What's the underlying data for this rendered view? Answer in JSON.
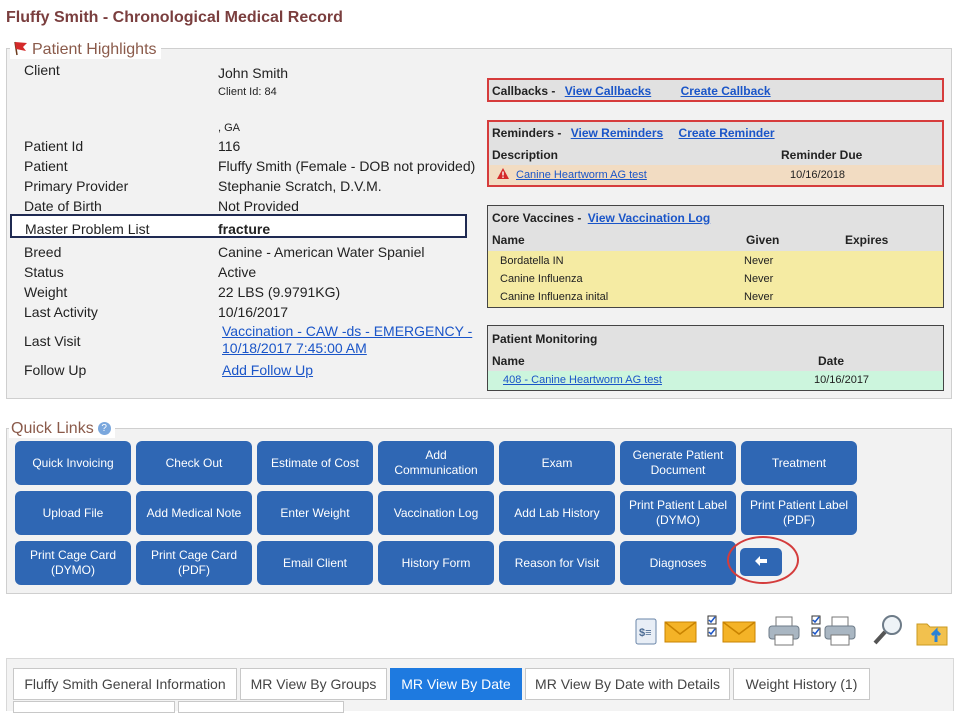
{
  "page": {
    "title": "Fluffy Smith - Chronological Medical Record"
  },
  "highlights": {
    "legend": "Patient Highlights",
    "client_label": "Client",
    "client_name": "John Smith",
    "client_id": "Client Id: 84",
    "address": ", GA",
    "rows": [
      {
        "label": "Patient Id",
        "value": "116"
      },
      {
        "label": "Patient",
        "value": "Fluffy Smith (Female - DOB not provided)"
      },
      {
        "label": "Primary Provider",
        "value": "Stephanie Scratch, D.V.M."
      },
      {
        "label": "Date of Birth",
        "value": "Not Provided"
      }
    ],
    "problem_label": "Master Problem List",
    "problem_value": "fracture",
    "rows2": [
      {
        "label": "Breed",
        "value": "Canine - American Water Spaniel"
      },
      {
        "label": "Status",
        "value": "Active"
      },
      {
        "label": "Weight",
        "value": "22 LBS (9.9791KG)"
      },
      {
        "label": "Last Activity",
        "value": "10/16/2017"
      }
    ],
    "last_visit_label": "Last Visit",
    "last_visit_line1": "Vaccination - CAW -ds - EMERGENCY -",
    "last_visit_line2": "10/18/2017 7:45:00 AM",
    "follow_up_label": "Follow Up",
    "follow_up_link": "Add Follow Up"
  },
  "callbacks": {
    "title": "Callbacks -",
    "view_link": "View Callbacks",
    "create_link": "Create Callback"
  },
  "reminders": {
    "title": "Reminders -",
    "view_link": "View Reminders",
    "create_link": "Create Reminder",
    "col_description": "Description",
    "col_due": "Reminder Due",
    "item_name": "Canine Heartworm AG test",
    "item_due": "10/16/2018"
  },
  "vaccines": {
    "title": "Core Vaccines -",
    "view_link": "View Vaccination Log",
    "col_name": "Name",
    "col_given": "Given",
    "col_expires": "Expires",
    "rows": [
      {
        "name": "Bordatella IN",
        "given": "Never",
        "expires": ""
      },
      {
        "name": "Canine Influenza",
        "given": "Never",
        "expires": ""
      },
      {
        "name": "Canine Influenza inital",
        "given": "Never",
        "expires": ""
      }
    ]
  },
  "monitoring": {
    "title": "Patient Monitoring",
    "col_name": "Name",
    "col_date": "Date",
    "item_name": "408 - Canine Heartworm AG test",
    "item_date": "10/16/2017"
  },
  "quick_links": {
    "legend": "Quick Links",
    "help": "?",
    "buttons": [
      "Quick Invoicing",
      "Check Out",
      "Estimate of Cost",
      "Add Communication",
      "Exam",
      "Generate Patient Document",
      "Treatment",
      "Upload File",
      "Add Medical Note",
      "Enter Weight",
      "Vaccination Log",
      "Add Lab History",
      "Print Patient Label (DYMO)",
      "Print Patient Label (PDF)",
      "Print Cage Card (DYMO)",
      "Print Cage Card (PDF)",
      "Email Client",
      "History Form",
      "Reason for Visit",
      "Diagnoses"
    ],
    "back_glyph": "🡐"
  },
  "toolbar_icons": [
    "invoice-icon",
    "email-icon",
    "email-checklist-icon",
    "print-icon",
    "print-checklist-icon",
    "search-icon",
    "upload-folder-icon"
  ],
  "tabs": [
    {
      "label": "Fluffy Smith General Information"
    },
    {
      "label": "MR View By Groups"
    },
    {
      "label": "MR View By Date"
    },
    {
      "label": "MR View By Date with Details"
    },
    {
      "label": "Weight History (1)"
    }
  ],
  "colors": {
    "button_blue": "#2f67b4",
    "active_tab": "#1e7ae0",
    "alert_red": "#d63c3c",
    "vaccine_yellow": "#f5eba3",
    "monitor_green": "#ccf5dd"
  }
}
